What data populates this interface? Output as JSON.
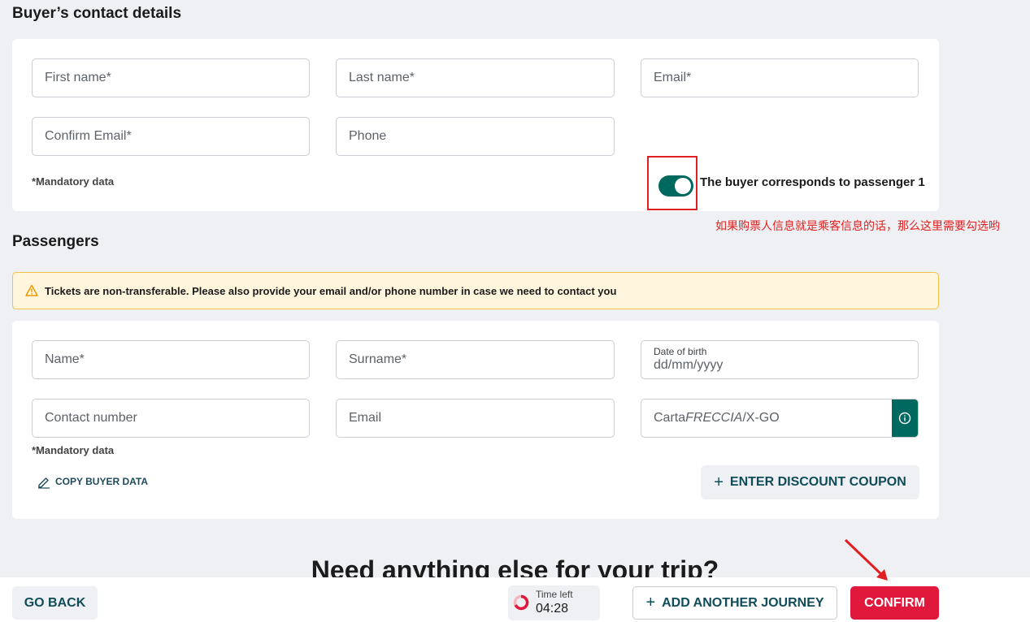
{
  "colors": {
    "accent_teal": "#00695f",
    "confirm_red": "#e0183c",
    "annotation_red": "#e02020",
    "warning_bg": "#fff5dc"
  },
  "buyer": {
    "title": "Buyer’s contact details",
    "first_name_placeholder": "First name*",
    "last_name_placeholder": "Last name*",
    "email_placeholder": "Email*",
    "confirm_email_placeholder": "Confirm Email*",
    "phone_placeholder": "Phone",
    "mandatory": "*Mandatory data",
    "toggle_label": "The buyer corresponds to passenger 1",
    "toggle_on": true
  },
  "annotation": "如果购票人信息就是乘客信息的话，那么这里需要勾选哟",
  "passengers": {
    "title": "Passengers",
    "warning": "Tickets are non-transferable. Please also provide your email and/or phone number in case we need to contact you",
    "name_placeholder": "Name*",
    "surname_placeholder": "Surname*",
    "dob_label": "Date of birth",
    "dob_placeholder": "dd/mm/yyyy",
    "contact_placeholder": "Contact number",
    "email_placeholder": "Email",
    "carta_prefix": "Carta",
    "carta_italic": "FRECCIA",
    "carta_suffix": "/X-GO",
    "mandatory": "*Mandatory data",
    "copy_buyer": "COPY BUYER DATA",
    "coupon": "ENTER DISCOUNT COUPON",
    "icons": {
      "warning": "warning-icon",
      "info": "info-icon",
      "edit": "pencil-icon",
      "plus": "plus-icon"
    }
  },
  "need_title": "Need anything else for your trip?",
  "footer": {
    "go_back": "GO BACK",
    "time_left_label": "Time left",
    "time_left_value": "04:28",
    "add_journey": "ADD ANOTHER JOURNEY",
    "confirm": "CONFIRM"
  }
}
